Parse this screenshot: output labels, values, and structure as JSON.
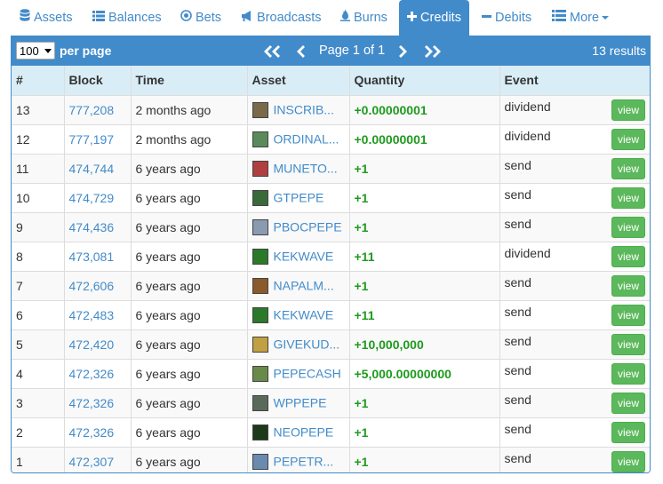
{
  "tabs": [
    {
      "label": "Assets",
      "icon": "database-icon",
      "active": false
    },
    {
      "label": "Balances",
      "icon": "list-icon",
      "active": false
    },
    {
      "label": "Bets",
      "icon": "target-icon",
      "active": false
    },
    {
      "label": "Broadcasts",
      "icon": "bullhorn-icon",
      "active": false
    },
    {
      "label": "Burns",
      "icon": "fire-icon",
      "active": false
    },
    {
      "label": "Credits",
      "icon": "plus-icon",
      "active": true
    },
    {
      "label": "Debits",
      "icon": "minus-icon",
      "active": false
    },
    {
      "label": "More",
      "icon": "list-icon",
      "active": false
    }
  ],
  "toolbar": {
    "per_page_value": "100",
    "per_page_label": "per page",
    "page_text": "Page 1 of 1",
    "results_text": "13 results"
  },
  "table": {
    "headers": [
      "#",
      "Block",
      "Time",
      "Asset",
      "Quantity",
      "Event"
    ],
    "view_label": "view",
    "rows": [
      {
        "num": "13",
        "block": "777,208",
        "time": "2 months ago",
        "asset": "INSCRIB...",
        "qty": "+0.00000001",
        "event": "dividend",
        "icon_color": "#7a6a4a"
      },
      {
        "num": "12",
        "block": "777,197",
        "time": "2 months ago",
        "asset": "ORDINAL...",
        "qty": "+0.00000001",
        "event": "dividend",
        "icon_color": "#5a8a5a"
      },
      {
        "num": "11",
        "block": "474,744",
        "time": "6 years ago",
        "asset": "MUNETO...",
        "qty": "+1",
        "event": "send",
        "icon_color": "#b04040"
      },
      {
        "num": "10",
        "block": "474,729",
        "time": "6 years ago",
        "asset": "GTPEPE",
        "qty": "+1",
        "event": "send",
        "icon_color": "#3a6a3a"
      },
      {
        "num": "9",
        "block": "474,436",
        "time": "6 years ago",
        "asset": "PBOCPEPE",
        "qty": "+1",
        "event": "send",
        "icon_color": "#8a9ab0"
      },
      {
        "num": "8",
        "block": "473,081",
        "time": "6 years ago",
        "asset": "KEKWAVE",
        "qty": "+11",
        "event": "dividend",
        "icon_color": "#2a7a2a"
      },
      {
        "num": "7",
        "block": "472,606",
        "time": "6 years ago",
        "asset": "NAPALM...",
        "qty": "+1",
        "event": "send",
        "icon_color": "#8a5a2a"
      },
      {
        "num": "6",
        "block": "472,483",
        "time": "6 years ago",
        "asset": "KEKWAVE",
        "qty": "+11",
        "event": "send",
        "icon_color": "#2a7a2a"
      },
      {
        "num": "5",
        "block": "472,420",
        "time": "6 years ago",
        "asset": "GIVEKUD...",
        "qty": "+10,000,000",
        "event": "send",
        "icon_color": "#c0a040"
      },
      {
        "num": "4",
        "block": "472,326",
        "time": "6 years ago",
        "asset": "PEPECASH",
        "qty": "+5,000.00000000",
        "event": "send",
        "icon_color": "#6a8a4a"
      },
      {
        "num": "3",
        "block": "472,326",
        "time": "6 years ago",
        "asset": "WPPEPE",
        "qty": "+1",
        "event": "send",
        "icon_color": "#5a6a5a"
      },
      {
        "num": "2",
        "block": "472,326",
        "time": "6 years ago",
        "asset": "NEOPEPE",
        "qty": "+1",
        "event": "send",
        "icon_color": "#1a3a1a"
      },
      {
        "num": "1",
        "block": "472,307",
        "time": "6 years ago",
        "asset": "PEPETR...",
        "qty": "+1",
        "event": "send",
        "icon_color": "#6a8ab0"
      }
    ]
  },
  "colors": {
    "accent": "#428bca",
    "header_bg": "#d9edf7",
    "quantity": "#1e9a1e",
    "view_button": "#5cb85c"
  }
}
